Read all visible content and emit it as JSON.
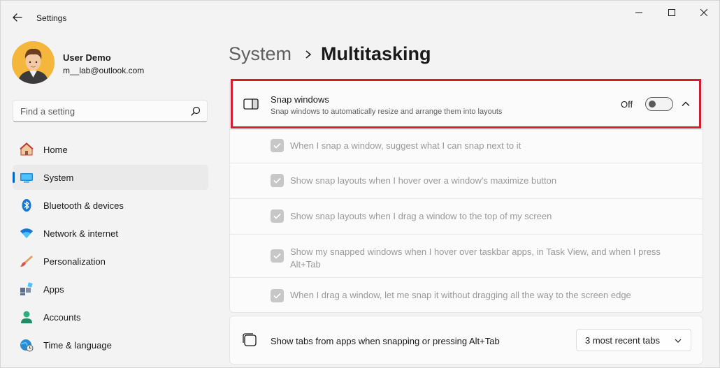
{
  "window": {
    "title": "Settings"
  },
  "profile": {
    "name": "User Demo",
    "email": "m__lab@outlook.com"
  },
  "search": {
    "placeholder": "Find a setting"
  },
  "sidebar": {
    "items": [
      {
        "label": "Home",
        "icon": "home-icon",
        "active": false
      },
      {
        "label": "System",
        "icon": "system-icon",
        "active": true
      },
      {
        "label": "Bluetooth & devices",
        "icon": "bluetooth-icon",
        "active": false
      },
      {
        "label": "Network & internet",
        "icon": "wifi-icon",
        "active": false
      },
      {
        "label": "Personalization",
        "icon": "brush-icon",
        "active": false
      },
      {
        "label": "Apps",
        "icon": "apps-icon",
        "active": false
      },
      {
        "label": "Accounts",
        "icon": "accounts-icon",
        "active": false
      },
      {
        "label": "Time & language",
        "icon": "globe-clock-icon",
        "active": false
      }
    ]
  },
  "breadcrumb": {
    "parent": "System",
    "current": "Multitasking"
  },
  "snap": {
    "title": "Snap windows",
    "description": "Snap windows to automatically resize and arrange them into layouts",
    "toggle_state": "Off",
    "options": [
      {
        "label": "When I snap a window, suggest what I can snap next to it",
        "checked": true,
        "disabled": true
      },
      {
        "label": "Show snap layouts when I hover over a window's maximize button",
        "checked": true,
        "disabled": true
      },
      {
        "label": "Show snap layouts when I drag a window to the top of my screen",
        "checked": true,
        "disabled": true
      },
      {
        "label": "Show my snapped windows when I hover over taskbar apps, in Task View, and when I press Alt+Tab",
        "checked": true,
        "disabled": true
      },
      {
        "label": "When I drag a window, let me snap it without dragging all the way to the screen edge",
        "checked": true,
        "disabled": true
      }
    ]
  },
  "tabs_setting": {
    "label": "Show tabs from apps when snapping or pressing Alt+Tab",
    "selected": "3 most recent tabs"
  },
  "colors": {
    "accent": "#0067c0",
    "highlight_border": "#d11f2e"
  }
}
